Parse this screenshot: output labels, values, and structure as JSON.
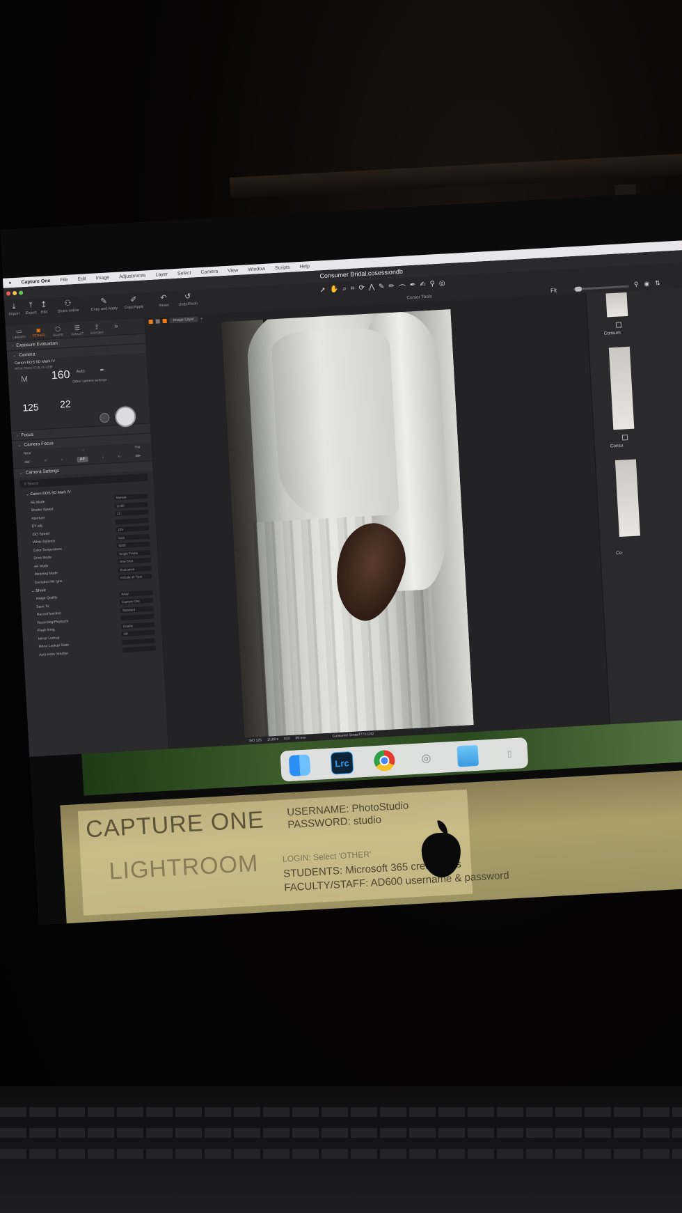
{
  "window": {
    "document_title": "Consumer Bridal.cosessiondb"
  },
  "menubar": {
    "app_name": "Capture One",
    "items": [
      "File",
      "Edit",
      "Image",
      "Adjustments",
      "Layer",
      "Select",
      "Camera",
      "View",
      "Window",
      "Scripts",
      "Help"
    ]
  },
  "toolbar": {
    "buttons": [
      {
        "label": "Import",
        "icon": "import-icon"
      },
      {
        "label": "Export",
        "icon": "export-icon"
      },
      {
        "label": "Edit",
        "icon": "edit-icon"
      },
      {
        "label": "Share online",
        "icon": "share-icon"
      },
      {
        "label": "Copy and Apply",
        "icon": "copy-apply-icon"
      },
      {
        "label": "Copy/Apply",
        "icon": "copy-icon"
      },
      {
        "label": "Reset",
        "icon": "reset-icon"
      },
      {
        "label": "Undo/Redo",
        "icon": "undo-icon"
      }
    ],
    "cursor_tools_label": "Cursor Tools",
    "zoom_label": "Fit"
  },
  "tool_tabs": [
    {
      "label": "LIBRARY",
      "active": false
    },
    {
      "label": "TETHER",
      "active": true
    },
    {
      "label": "SHAPE",
      "active": false
    },
    {
      "label": "ADJUST",
      "active": false
    },
    {
      "label": "EXPORT",
      "active": false
    }
  ],
  "panels": {
    "exposure_evaluation": "Exposure Evaluation",
    "camera": {
      "title": "Camera",
      "model": "Canon EOS 5D Mark IV",
      "lens": "RF24-70mm F2.8L IS USM",
      "mode": "M",
      "iso": "160",
      "shutter": "125",
      "aperture": "22",
      "wb": "Auto",
      "other": "Other camera settings"
    },
    "focus": {
      "title": "Focus"
    },
    "camera_focus": {
      "title": "Camera Focus",
      "near": "Near",
      "far": "Far"
    },
    "camera_settings": {
      "title": "Camera Settings",
      "search_placeholder": "Search",
      "device": "Canon EOS 5D Mark IV",
      "rows": [
        {
          "label": "AE Mode",
          "value": "Manual"
        },
        {
          "label": "Shutter Speed",
          "value": "1/160"
        },
        {
          "label": "Aperture",
          "value": "22"
        },
        {
          "label": "EV adj.",
          "value": ""
        },
        {
          "label": "ISO Speed",
          "value": "125"
        },
        {
          "label": "White Balance",
          "value": "Auto"
        },
        {
          "label": "Color Temperature",
          "value": "5200"
        },
        {
          "label": "Drive Mode",
          "value": "Single Frame"
        },
        {
          "label": "AF Mode",
          "value": "One-Shot"
        },
        {
          "label": "Metering Mode",
          "value": "Evaluative"
        },
        {
          "label": "Excluded file type",
          "value": "Include all Type"
        }
      ],
      "shoot_group": "Shoot",
      "shoot_rows": [
        {
          "label": "Image Quality",
          "value": "RAW"
        },
        {
          "label": "Save To",
          "value": "Capture One"
        },
        {
          "label": "Record function",
          "value": "Standard"
        },
        {
          "label": "Recording/Playback",
          "value": ""
        },
        {
          "label": "Flash firing",
          "value": "Enable"
        },
        {
          "label": "Mirror Lockup",
          "value": "Off"
        },
        {
          "label": "Mirror Lockup State",
          "value": ""
        },
        {
          "label": "Auto expo. bracket",
          "value": ""
        }
      ]
    }
  },
  "viewer": {
    "layer_label": "Image Layer",
    "info": {
      "iso": "ISO 125",
      "shutter": "1/160 s",
      "aperture": "f/22",
      "focal": "69 mm",
      "filename": "Consumer Bridal7773.CR2"
    }
  },
  "browser": {
    "thumb_labels": [
      "Consum",
      "Consu",
      "Co"
    ]
  },
  "dock": {
    "apps": [
      {
        "name": "Finder",
        "icon": "finder-icon"
      },
      {
        "name": "Lightroom Classic",
        "label": "Lrc",
        "icon": "lightroom-icon"
      },
      {
        "name": "Chrome",
        "icon": "chrome-icon"
      },
      {
        "name": "System",
        "icon": "system-icon"
      },
      {
        "name": "Folder",
        "icon": "folder-icon"
      },
      {
        "name": "Trash",
        "icon": "trash-icon"
      }
    ]
  },
  "sticker": {
    "capture_one": "CAPTURE ONE",
    "username": "USERNAME: PhotoStudio",
    "password": "PASSWORD: studio",
    "lightroom": "LIGHTROOM",
    "login_line": "LOGIN: Select 'OTHER'",
    "students": "STUDENTS: Microsoft 365 credentials",
    "faculty": "FACULTY/STAFF: AD600 username & password"
  }
}
